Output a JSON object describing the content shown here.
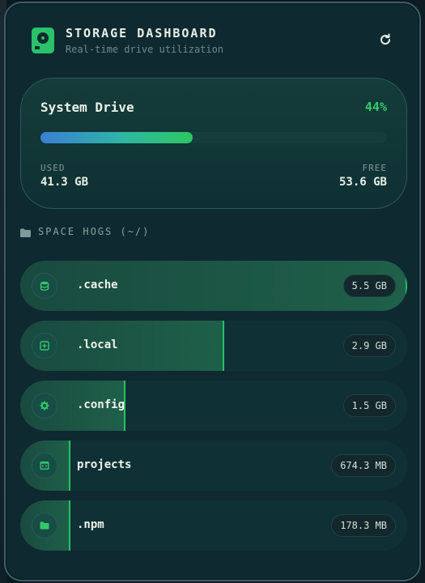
{
  "header": {
    "title": "STORAGE DASHBOARD",
    "subtitle": "Real-time drive utilization",
    "refresh_icon": "refresh-icon",
    "app_icon": "hard-drive-icon"
  },
  "drive": {
    "name": "System Drive",
    "percent_label": "44%",
    "used_fraction": 0.44,
    "used_label": "USED",
    "used_value": "41.3 GB",
    "free_label": "FREE",
    "free_value": "53.6 GB"
  },
  "section": {
    "title": "SPACE HOGS (~/)",
    "icon": "folder-icon"
  },
  "items": [
    {
      "name": ".cache",
      "size": "5.5 GB",
      "fraction": 1.0,
      "icon": "database-icon"
    },
    {
      "name": ".local",
      "size": "2.9 GB",
      "fraction": 0.527,
      "icon": "box-icon"
    },
    {
      "name": ".config",
      "size": "1.5 GB",
      "fraction": 0.273,
      "icon": "gear-icon"
    },
    {
      "name": "projects",
      "size": "674.3 MB",
      "fraction": 0.12,
      "icon": "code-window-icon"
    },
    {
      "name": ".npm",
      "size": "178.3 MB",
      "fraction": 0.032,
      "icon": "folder-icon"
    }
  ],
  "colors": {
    "accent": "#2bc862",
    "progress_start": "#3a7fd6",
    "panel_bg": "#0e2a30"
  }
}
